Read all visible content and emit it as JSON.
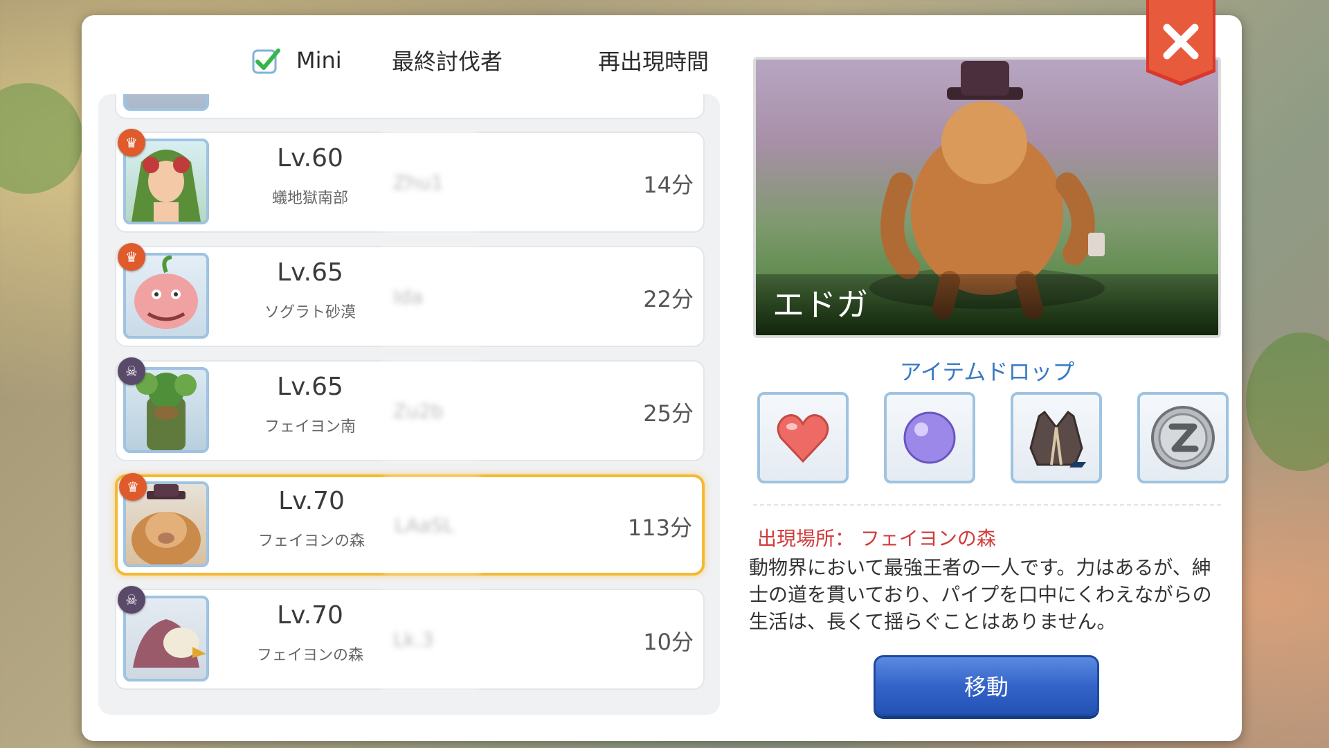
{
  "header": {
    "mini_label": "Mini",
    "last_killer_label": "最終討伐者",
    "respawn_label": "再出現時間"
  },
  "rows": [
    {
      "level": "Lv.60",
      "location": "蟻地獄南部",
      "killer": "Zhu1",
      "respawn": "14分",
      "badge": "mini",
      "selected": false
    },
    {
      "level": "Lv.65",
      "location": "ソグラト砂漠",
      "killer": "Ida",
      "respawn": "22分",
      "badge": "mini",
      "selected": false
    },
    {
      "level": "Lv.65",
      "location": "フェイヨン南",
      "killer": "Zu2b",
      "respawn": "25分",
      "badge": "mvp",
      "selected": false
    },
    {
      "level": "Lv.70",
      "location": "フェイヨンの森",
      "killer": "LAaSL",
      "respawn": "113分",
      "badge": "mini",
      "selected": true
    },
    {
      "level": "Lv.70",
      "location": "フェイヨンの森",
      "killer": "Lk.3",
      "respawn": "10分",
      "badge": "mvp",
      "selected": false
    }
  ],
  "detail": {
    "monster_name": "エドガ",
    "drops_title": "アイテムドロップ",
    "drops": [
      "heart-item",
      "purple-orb-item",
      "jacket-item",
      "zeny-coin-item"
    ],
    "spawn_label": "出現場所：",
    "spawn_location": "フェイヨンの森",
    "description": "動物界において最強王者の一人です。力はあるが、紳士の道を貫いており、パイプを口中にくわえながらの生活は、長くて揺らぐことはありません。",
    "move_button": "移動"
  },
  "colors": {
    "selected_border": "#f5b933",
    "spawn_text": "#d23a3a",
    "drops_title": "#3a79c5",
    "move_button": "#3464c9",
    "close_button": "#d9382a"
  }
}
